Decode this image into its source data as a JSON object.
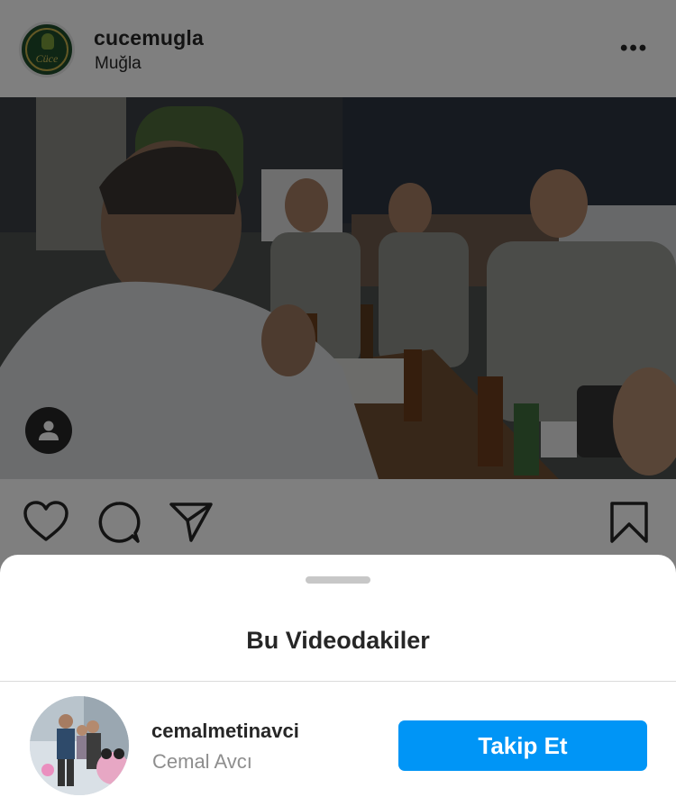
{
  "post": {
    "username": "cucemugla",
    "location": "Muğla",
    "more_label": "•••",
    "logo_text": "Cüce"
  },
  "icons": {
    "like": "heart-icon",
    "comment": "comment-icon",
    "share": "paper-plane-icon",
    "save": "bookmark-icon",
    "more": "more-options-icon",
    "tagged_users": "user-tag-icon"
  },
  "sheet": {
    "title": "Bu Videodakiler",
    "people": [
      {
        "username": "cemalmetinavci",
        "full_name": "Cemal Avcı",
        "follow_label": "Takip Et"
      }
    ]
  },
  "colors": {
    "follow_button": "#0095f6",
    "overlay": "rgba(0,0,0,0.5)",
    "text_primary": "#262626",
    "text_secondary": "#8e8e8e"
  }
}
